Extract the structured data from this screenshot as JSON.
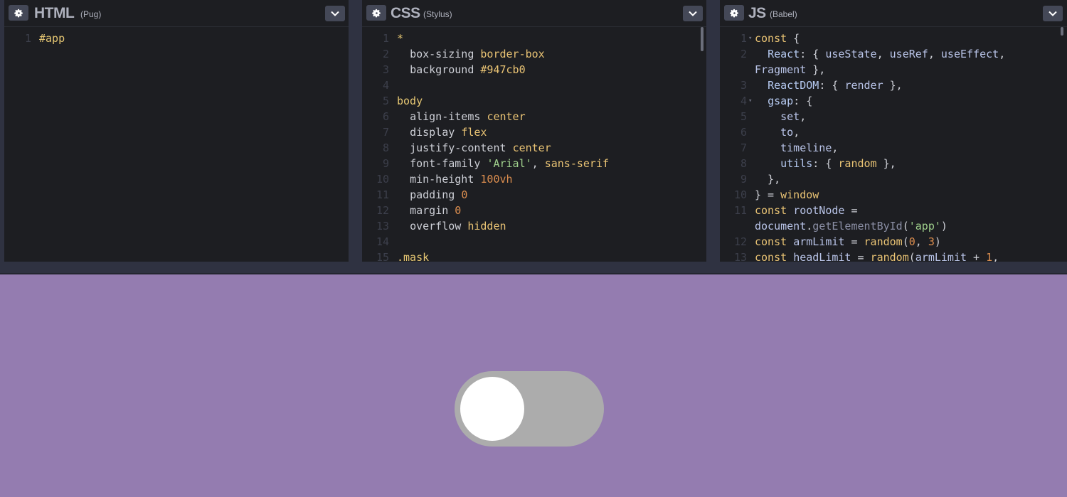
{
  "colors": {
    "page_background": "#947cb0",
    "editor_background": "#1d1e22",
    "toggle_track": "#acacac",
    "toggle_knob": "#ffffff"
  },
  "panes": {
    "html": {
      "title": "HTML",
      "subtitle": "(Pug)",
      "gear_icon": "gear-icon",
      "collapse_icon": "chevron-down-icon",
      "lines": [
        "#app"
      ]
    },
    "css": {
      "title": "CSS",
      "subtitle": "(Stylus)",
      "gear_icon": "gear-icon",
      "collapse_icon": "chevron-down-icon",
      "lines": [
        "*",
        "  box-sizing border-box",
        "  background #947cb0",
        "",
        "body",
        "  align-items center",
        "  display flex",
        "  justify-content center",
        "  font-family 'Arial', sans-serif",
        "  min-height 100vh",
        "  padding 0",
        "  margin 0",
        "  overflow hidden",
        "",
        ".mask"
      ]
    },
    "js": {
      "title": "JS",
      "subtitle": "(Babel)",
      "gear_icon": "gear-icon",
      "collapse_icon": "chevron-down-icon",
      "lines": [
        "const {",
        "  React: { useState, useRef, useEffect,",
        "Fragment },",
        "  ReactDOM: { render },",
        "  gsap: {",
        "    set,",
        "    to,",
        "    timeline,",
        "    utils: { random },",
        "  },",
        "} = window",
        "const rootNode =",
        "document.getElementById('app')",
        "const armLimit = random(0, 3)",
        "const headLimit = random(armLimit + 1,"
      ]
    }
  },
  "preview": {
    "toggle_state": "off"
  }
}
